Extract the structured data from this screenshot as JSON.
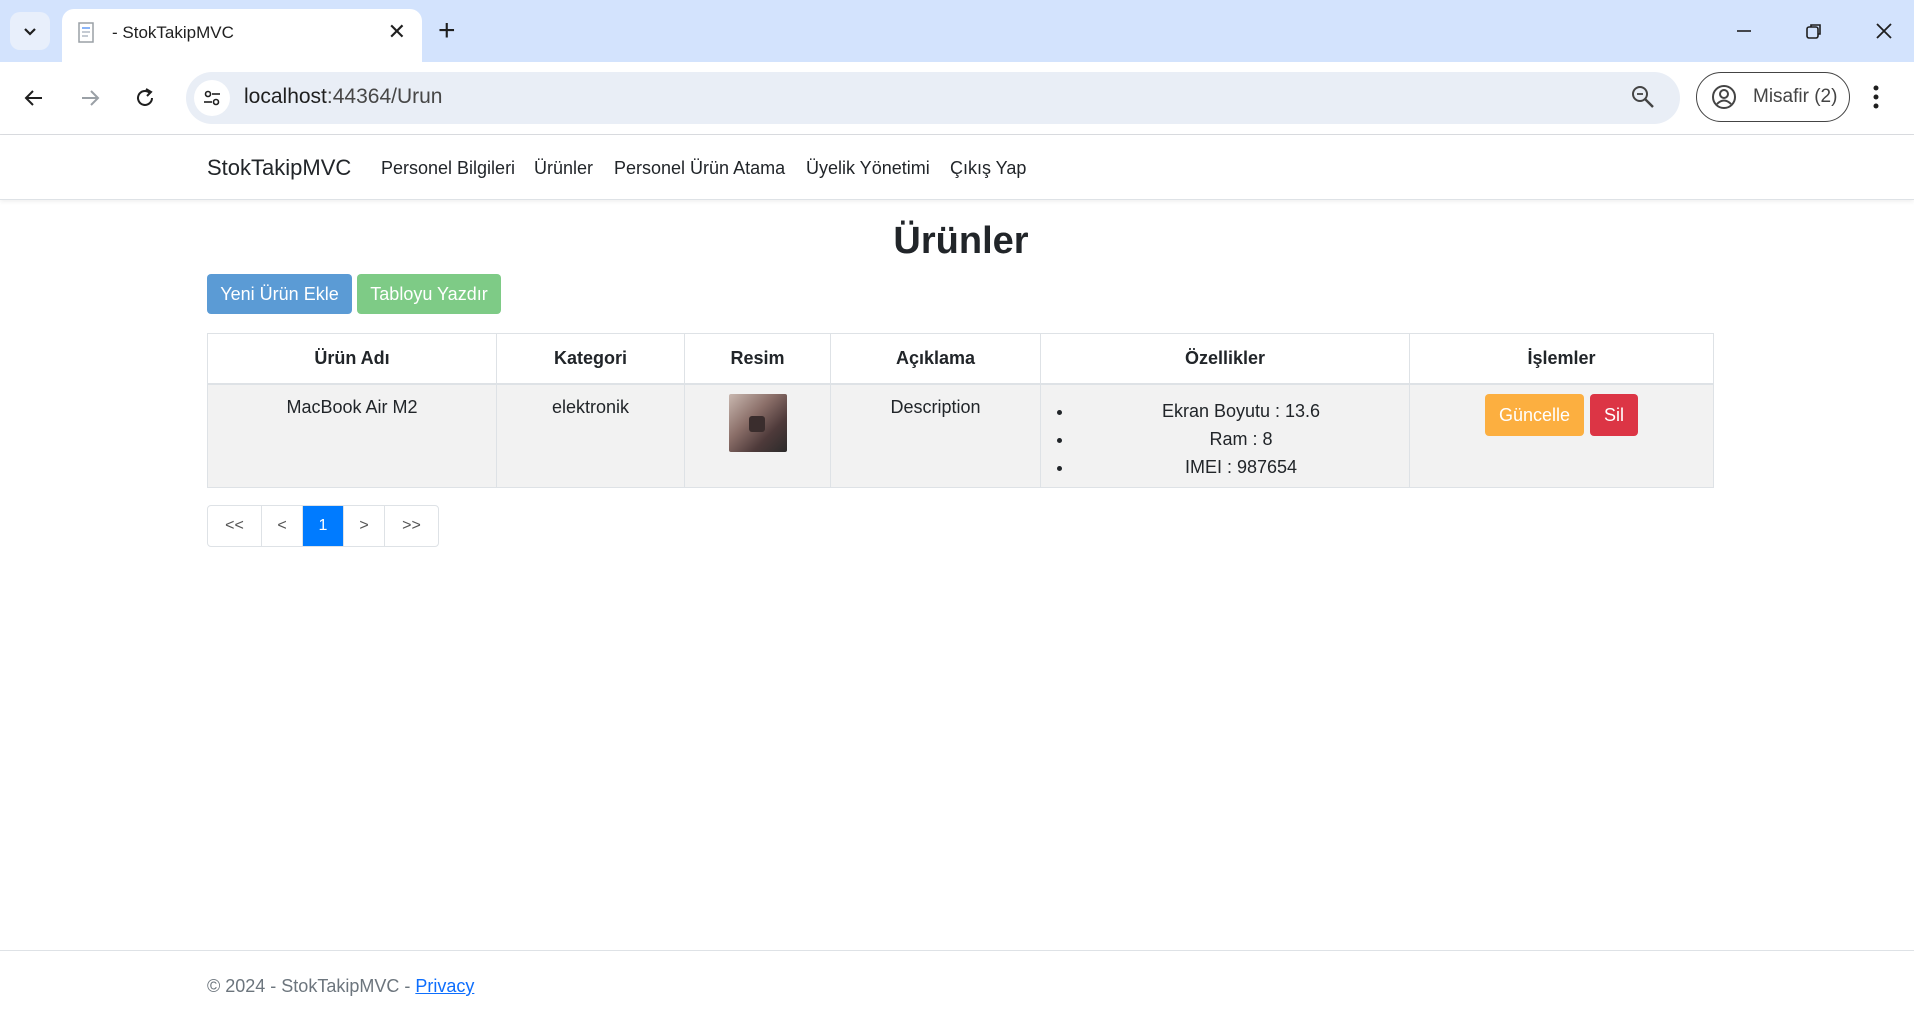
{
  "browser": {
    "tab_title": "- StokTakipMVC",
    "url_host": "localhost",
    "url_path": ":44364/Urun",
    "profile_label": "Misafir (2)"
  },
  "navbar": {
    "brand": "StokTakipMVC",
    "links": [
      "Personel Bilgileri",
      "Ürünler",
      "Personel Ürün Atama",
      "Üyelik Yönetimi",
      "Çıkış Yap"
    ]
  },
  "page": {
    "title": "Ürünler",
    "add_button": "Yeni Ürün Ekle",
    "print_button": "Tabloyu Yazdır"
  },
  "table": {
    "headers": [
      "Ürün Adı",
      "Kategori",
      "Resim",
      "Açıklama",
      "Özellikler",
      "İşlemler"
    ],
    "rows": [
      {
        "name": "MacBook Air M2",
        "category": "elektronik",
        "image_icon": "laptop-photo",
        "description": "Description",
        "features": [
          "Ekran Boyutu : 13.6",
          "Ram : 8",
          "IMEI : 987654"
        ],
        "update_label": "Güncelle",
        "delete_label": "Sil"
      }
    ]
  },
  "pagination": {
    "first": "<<",
    "prev": "<",
    "current": "1",
    "next": ">",
    "last": ">>"
  },
  "footer": {
    "text": "© 2024 - StokTakipMVC - ",
    "privacy_link": "Privacy"
  },
  "colors": {
    "add_button": "#5b9bd5",
    "print_button": "#7ecb86",
    "update_button": "#fcaf40",
    "delete_button": "#dc3545",
    "active_page": "#007bff"
  }
}
